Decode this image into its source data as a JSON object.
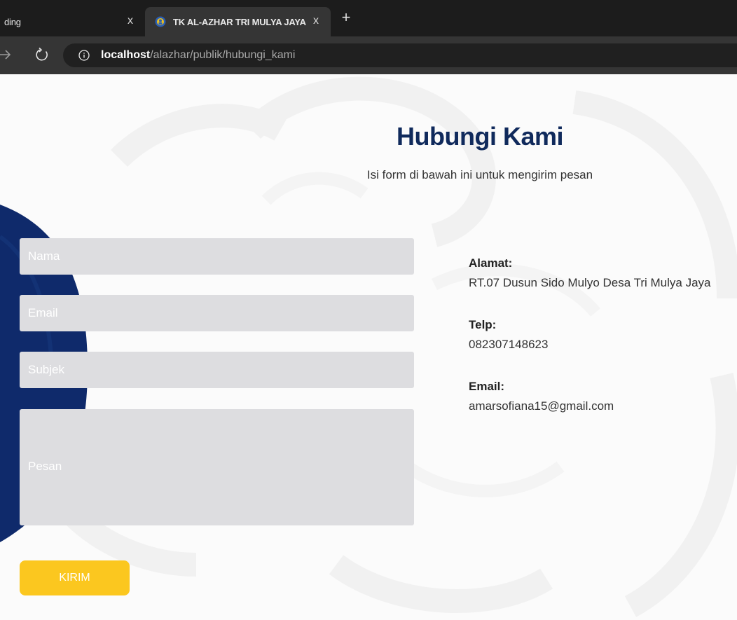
{
  "browser": {
    "tabs": [
      {
        "title": "ding",
        "active": false
      },
      {
        "title": "TK AL-AZHAR TRI MULYA JAYA",
        "active": true
      }
    ],
    "tab_close_glyph": "x",
    "new_tab_glyph": "+",
    "url_host": "localhost",
    "url_path": "/alazhar/publik/hubungi_kami"
  },
  "page": {
    "title": "Hubungi Kami",
    "subtitle": "Isi form di bawah ini untuk mengirim pesan",
    "form": {
      "nama_placeholder": "Nama",
      "email_placeholder": "Email",
      "subjek_placeholder": "Subjek",
      "pesan_placeholder": "Pesan",
      "submit_label": "KIRIM"
    },
    "contact": {
      "alamat_label": "Alamat:",
      "alamat_value": "RT.07 Dusun Sido Mulyo Desa Tri Mulya Jaya",
      "telp_label": "Telp:",
      "telp_value": "082307148623",
      "email_label": "Email:",
      "email_value": "amarsofiana15@gmail.com"
    }
  },
  "colors": {
    "title": "#102a5c",
    "button": "#fbc71f",
    "field": "#dddde0",
    "decor_shape": "#0f2a6b"
  },
  "icons": [
    "tab-favicon-icon",
    "close-icon",
    "plus-icon",
    "forward-arrow-icon",
    "reload-icon",
    "info-icon"
  ]
}
